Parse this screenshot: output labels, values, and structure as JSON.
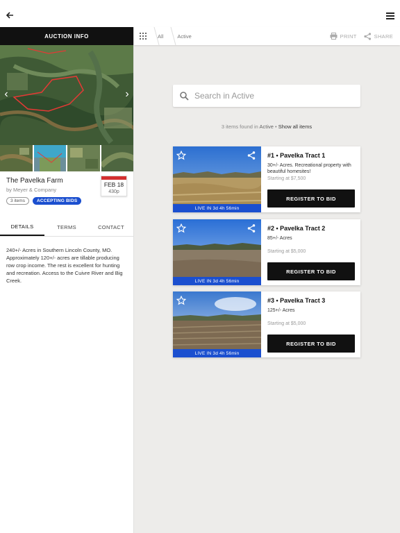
{
  "topbar": {
    "back_icon": "arrow-left-icon",
    "menu_icon": "hamburger-menu-icon"
  },
  "left": {
    "header": "AUCTION INFO",
    "farm": {
      "title": "The Pavelka Farm",
      "by": "by Meyer & Company",
      "items_badge": "3 items",
      "status_badge": "ACCEPTING BIDS",
      "date": "FEB 18",
      "time": "430p"
    },
    "tabs": [
      {
        "label": "DETAILS",
        "active": true
      },
      {
        "label": "TERMS",
        "active": false
      },
      {
        "label": "CONTACT",
        "active": false
      }
    ],
    "description": "240+/- Acres in Southern Lincoln County, MO. Approximately 120+/- acres are tillable producing row crop income. The rest is excellent for hunting and recreation. Access to the Cuivre River and Big Creek."
  },
  "crumbs": {
    "all": "All",
    "active": "Active",
    "print": "PRINT",
    "share": "SHARE"
  },
  "search": {
    "placeholder": "Search in Active"
  },
  "found": {
    "count_text": "3 items found in ",
    "filter": "Active",
    "dot": " • ",
    "show_all": "Show all items"
  },
  "lots": [
    {
      "title": "#1 • Pavelka Tract 1",
      "subtitle": "30+/- Acres. Recreational property with beautiful homesites!",
      "price": "Starting at $7,500",
      "live": "LIVE IN 3d 4h 56min",
      "button": "REGISTER TO BID"
    },
    {
      "title": "#2 • Pavelka Tract 2",
      "subtitle": "85+/- Acres",
      "price": "Starting at $5,000",
      "live": "LIVE IN 3d 4h 56min",
      "button": "REGISTER TO BID"
    },
    {
      "title": "#3 • Pavelka Tract 3",
      "subtitle": "125+/- Acres",
      "price": "Starting at $5,000",
      "live": "LIVE IN 3d 4h 56min",
      "button": "REGISTER TO BID"
    }
  ],
  "colors": {
    "accent_blue": "#1b4fcf",
    "calendar_red": "#d32f2f",
    "panel_bg": "#edecea"
  }
}
